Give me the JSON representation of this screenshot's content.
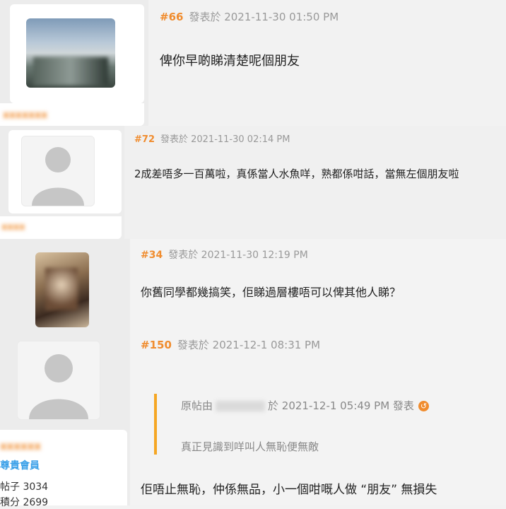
{
  "posts": [
    {
      "number": "#66",
      "meta": "發表於 2021-11-30 01:50 PM",
      "content": "俾你早啲睇清楚呢個朋友",
      "author": "xxxxxxx"
    },
    {
      "number": "#72",
      "meta": "發表於 2021-11-30 02:14 PM",
      "content": "2成差唔多一百萬啦，真係當人水魚咩，熟都係咁話，當無左個朋友啦",
      "author": "xxxx"
    },
    {
      "number": "#34",
      "meta": "發表於 2021-11-30 12:19 PM",
      "content": "你舊同學都幾搞笑，佢睇過層樓唔可以俾其他人睇？"
    },
    {
      "number": "#150",
      "meta": "發表於 2021-12-1 08:31 PM",
      "quote": {
        "prefix": "原帖由",
        "suffix": "於 2021-12-1 05:49 PM 發表",
        "text": "真正見識到咩叫人無恥便無敵"
      },
      "content": "佢唔止無恥，仲係無品，小一個咁嘅人做 “朋友” 無損失",
      "author": "xxxxxx",
      "role": "尊貴會員",
      "stats": [
        {
          "label": "帖子",
          "value": "3034"
        },
        {
          "label": "積分",
          "value": "2699"
        }
      ]
    }
  ],
  "colors": {
    "accent": "#f08c2e",
    "role": "#3aa0e8",
    "quote_bar": "#f5a623"
  }
}
